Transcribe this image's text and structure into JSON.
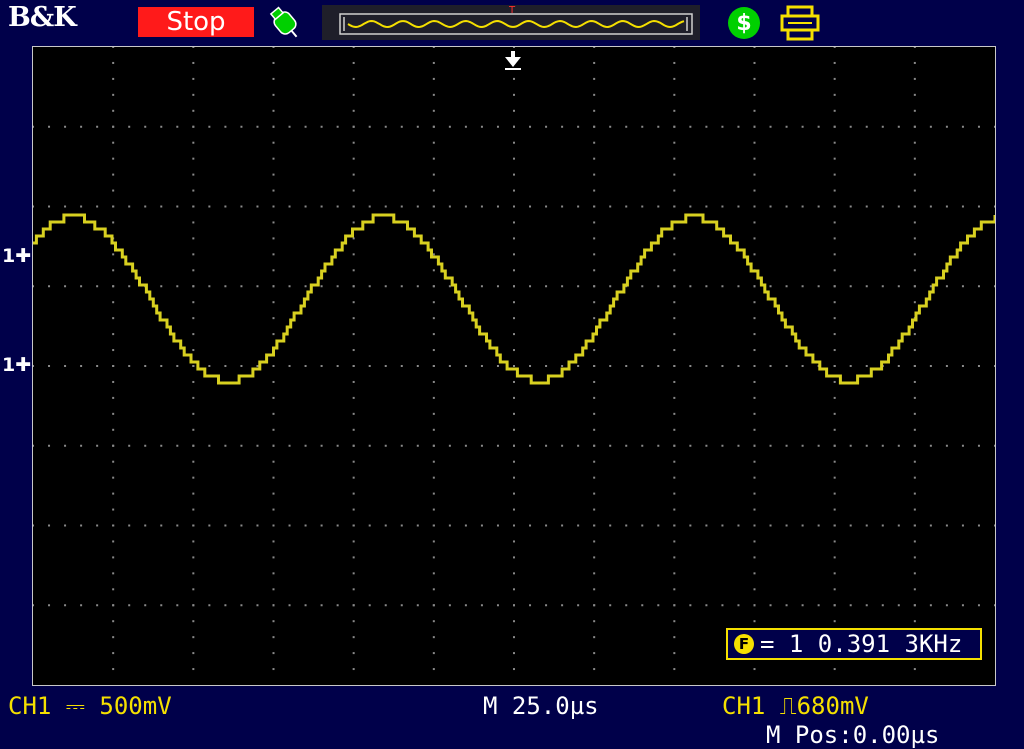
{
  "header": {
    "brand": "B&K",
    "run_state": "Stop",
    "icons": [
      "probe-icon",
      "waveform-overview",
      "usb-icon",
      "printer-icon"
    ]
  },
  "colors": {
    "background": "#00004a",
    "trace": "#d8d020",
    "stop_bg": "#ff1a1a",
    "accent_green": "#00d000",
    "accent_yellow": "#f5e000"
  },
  "screen": {
    "ch1_marker_upper": "1",
    "ch1_marker_lower": "1",
    "frequency": {
      "label": "= 1 0.391 3KHz"
    }
  },
  "status_bar": {
    "ch1_scale": "CH1 ⎓ 500mV",
    "timebase": "M 25.0µs",
    "trigger_level": "CH1 ⎍680mV",
    "m_pos": "M Pos:0.00µs"
  }
}
